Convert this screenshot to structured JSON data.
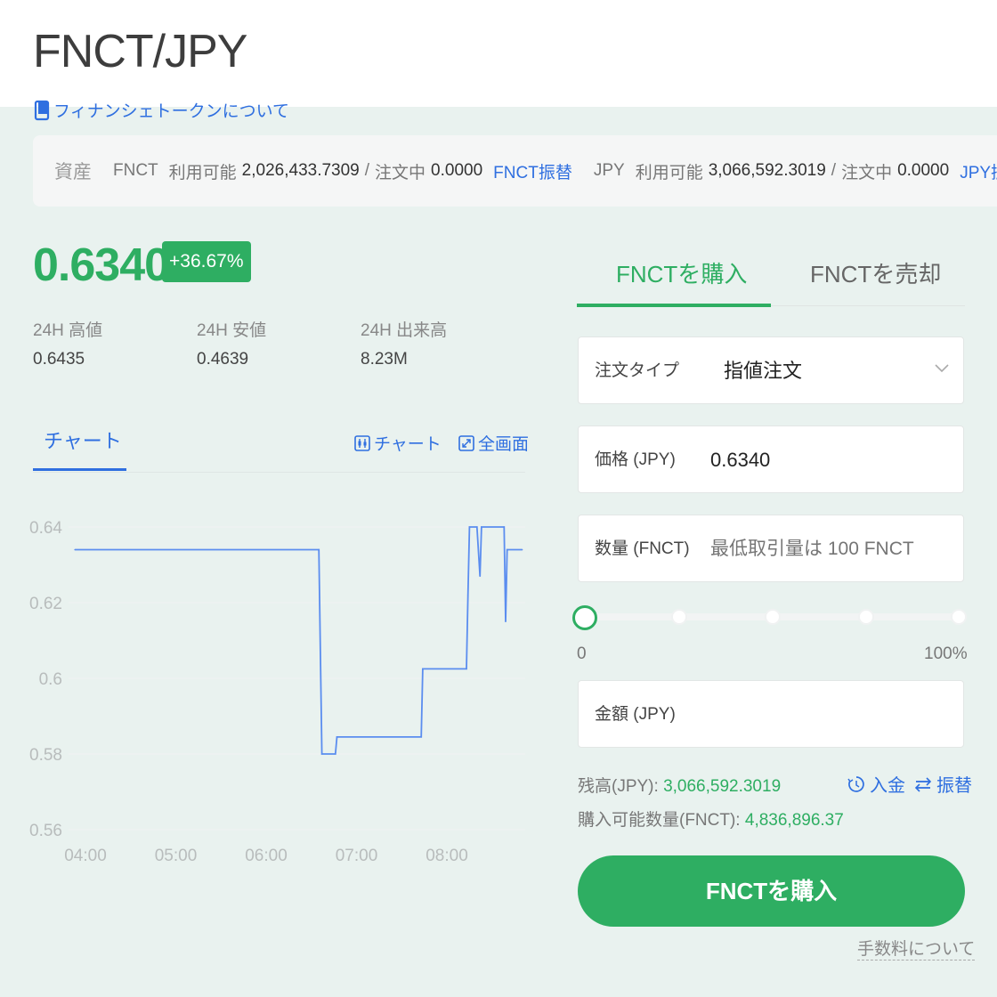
{
  "header": {
    "pair": "FNCT/JPY",
    "about_link": "フィナンシェトークンについて"
  },
  "assets": {
    "label": "資産",
    "fnct": {
      "currency": "FNCT",
      "available_label": "利用可能",
      "available": "2,026,433.7309",
      "separator": "/",
      "ordering_label": "注文中",
      "ordering": "0.0000",
      "transfer_link": "FNCT振替"
    },
    "jpy": {
      "currency": "JPY",
      "available_label": "利用可能",
      "available": "3,066,592.3019",
      "separator": "/",
      "ordering_label": "注文中",
      "ordering": "0.0000",
      "transfer_link": "JPY振替"
    }
  },
  "ticker": {
    "price": "0.6340",
    "change": "+36.67%",
    "stats": [
      {
        "label": "24H 高値",
        "value": "0.6435"
      },
      {
        "label": "24H 安値",
        "value": "0.4639"
      },
      {
        "label": "24H 出来高",
        "value": "8.23M"
      }
    ]
  },
  "chart_panel": {
    "tab": "チャート",
    "chart_button": "チャート",
    "fullscreen_button": "全画面"
  },
  "chart_data": {
    "type": "line",
    "x_ticks": [
      "04:00",
      "05:00",
      "06:00",
      "07:00",
      "08:00"
    ],
    "y_ticks": [
      "0.64",
      "0.62",
      "0.6",
      "0.58",
      "0.56"
    ],
    "ylim": [
      0.56,
      0.64
    ],
    "x": [
      "03:53",
      "06:35",
      "06:37",
      "06:46",
      "06:47",
      "07:43",
      "07:44",
      "08:13",
      "08:14",
      "08:15",
      "08:20",
      "08:22",
      "08:23",
      "08:38",
      "08:39",
      "08:40",
      "08:50"
    ],
    "series": [
      {
        "values": [
          0.634,
          0.634,
          0.58,
          0.58,
          0.5845,
          0.5845,
          0.6025,
          0.6025,
          0.622,
          0.64,
          0.64,
          0.627,
          0.64,
          0.64,
          0.615,
          0.634,
          0.634
        ]
      }
    ],
    "grid": true,
    "color": "#5b8def"
  },
  "trade": {
    "buy_tab": "FNCTを購入",
    "sell_tab": "FNCTを売却",
    "order_type_label": "注文タイプ",
    "order_type_value": "指値注文",
    "price_label": "価格 (JPY)",
    "price_value": "0.6340",
    "quantity_label": "数量 (FNCT)",
    "quantity_placeholder": "最低取引量は 100 FNCT",
    "slider_percent": 0,
    "slider_min": "0",
    "slider_max": "100%",
    "amount_label": "金額 (JPY)",
    "balance_label": "残高(JPY):",
    "balance_value": "3,066,592.3019",
    "buyable_label": "購入可能数量(FNCT):",
    "buyable_value": "4,836,896.37",
    "deposit_link": "入金",
    "transfer_link": "振替",
    "submit_button": "FNCTを購入",
    "fee_link": "手数料について"
  },
  "colors": {
    "accent_green": "#2eae62",
    "link_blue": "#2f6fe0",
    "background": "#e9f2ef"
  }
}
